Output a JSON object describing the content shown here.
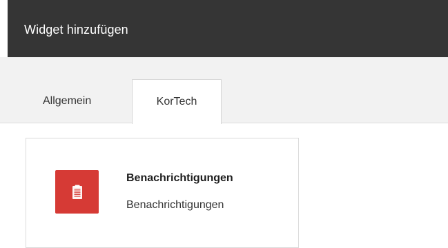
{
  "dialog": {
    "title": "Widget hinzufügen"
  },
  "tabs": [
    {
      "label": "Allgemein",
      "active": false
    },
    {
      "label": "KorTech",
      "active": true
    }
  ],
  "widgets": [
    {
      "icon": "clipboard-list-icon",
      "title": "Benachrichtigungen",
      "subtitle": "Benachrichtigungen",
      "icon_color": "#d63a35"
    }
  ],
  "colors": {
    "titlebar": "#353535",
    "tabbar": "#f2f2f2",
    "accent": "#d63a35"
  }
}
